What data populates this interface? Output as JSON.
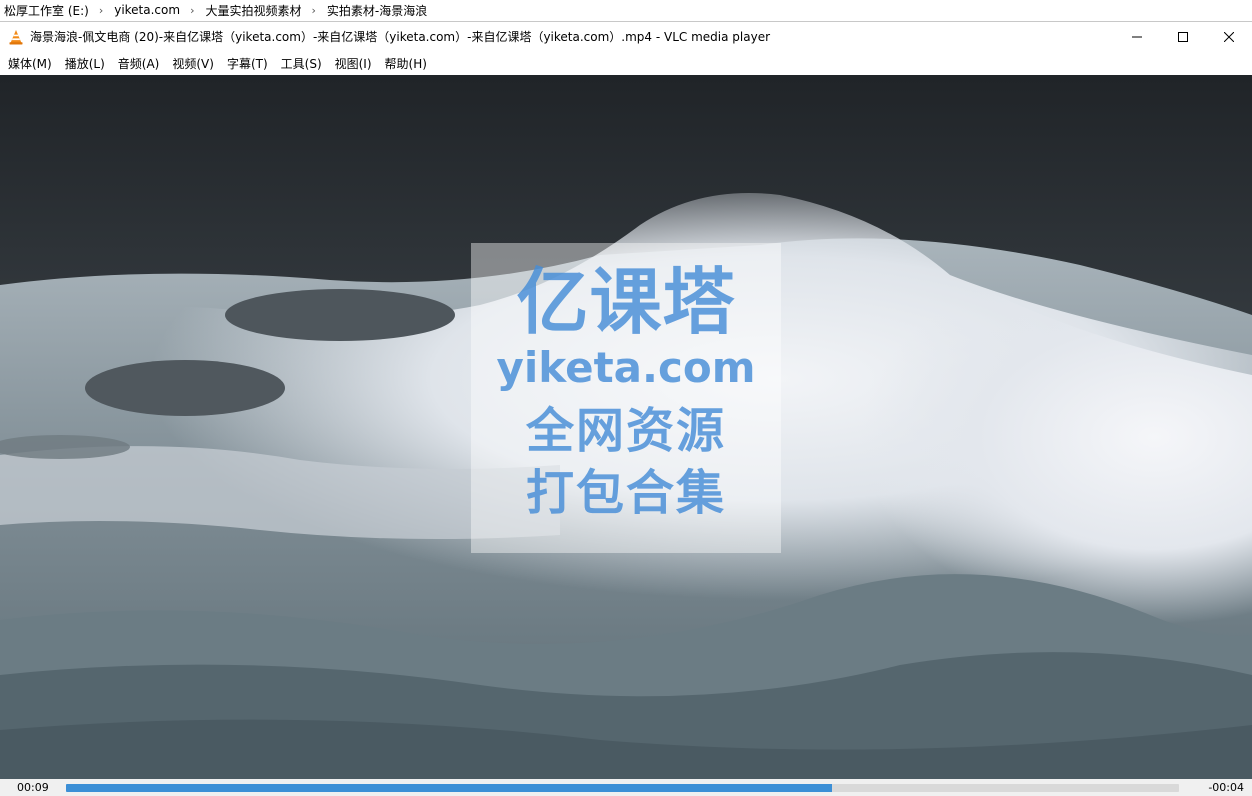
{
  "explorer": {
    "breadcrumbs": [
      "松厚工作室 (E:)",
      "yiketa.com",
      "大量实拍视频素材",
      "实拍素材-海景海浪"
    ],
    "separator": "›"
  },
  "window": {
    "title": "海景海浪-佩文电商 (20)-来自亿课塔（yiketa.com）-来自亿课塔（yiketa.com）-来自亿课塔（yiketa.com）.mp4 - VLC media player",
    "app_icon": "vlc-cone-icon",
    "controls": [
      "minimize-icon",
      "maximize-icon",
      "close-icon"
    ]
  },
  "menu": {
    "items": [
      "媒体(M)",
      "播放(L)",
      "音频(A)",
      "视频(V)",
      "字幕(T)",
      "工具(S)",
      "视图(I)",
      "帮助(H)"
    ]
  },
  "video": {
    "watermark": {
      "line1": "亿课塔",
      "line2": "yiketa.com",
      "line3": "全网资源",
      "line4": "打包合集"
    }
  },
  "playback": {
    "elapsed": "00:09",
    "remaining": "-00:04",
    "progress_fraction": 0.688,
    "accent_color": "#3c8fd6"
  }
}
